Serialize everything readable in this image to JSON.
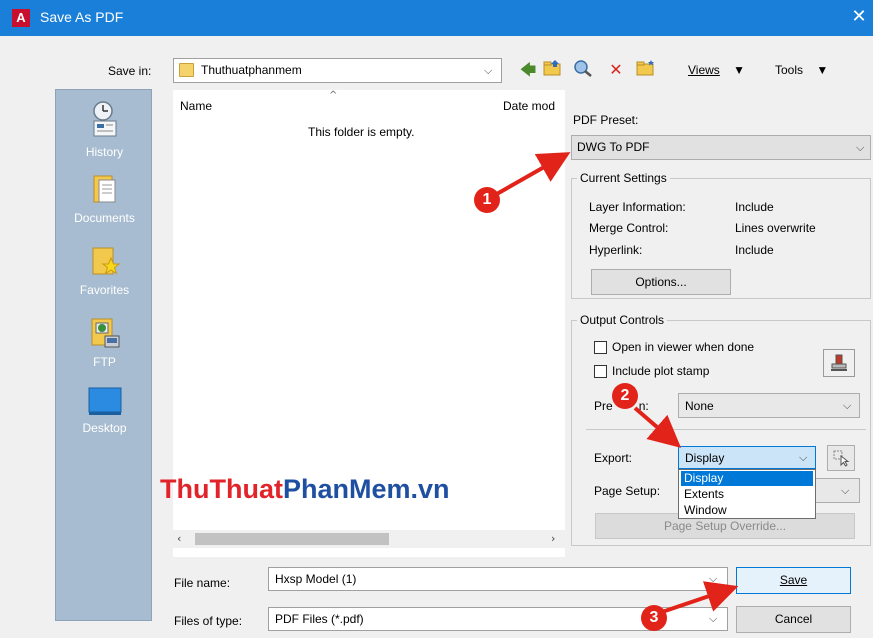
{
  "window": {
    "title": "Save As PDF",
    "close_glyph": "✕"
  },
  "savein": {
    "label": "Save in:",
    "value": "Thuthuatphanmem"
  },
  "toolbar": {
    "views": "Views",
    "tools": "Tools"
  },
  "places": [
    {
      "label": "History",
      "icon": "history-icon"
    },
    {
      "label": "Documents",
      "icon": "documents-icon"
    },
    {
      "label": "Favorites",
      "icon": "favorites-icon"
    },
    {
      "label": "FTP",
      "icon": "ftp-icon"
    },
    {
      "label": "Desktop",
      "icon": "desktop-icon"
    }
  ],
  "filelist": {
    "col_name": "Name",
    "col_date": "Date mod",
    "empty_message": "This folder is empty."
  },
  "watermark": {
    "part1": "ThuThuat",
    "part2": "PhanMem",
    "part3": ".vn"
  },
  "preset": {
    "label": "PDF Preset:",
    "value": "DWG To PDF"
  },
  "current_settings": {
    "title": "Current Settings",
    "rows": [
      {
        "key": "Layer Information:",
        "value": "Include"
      },
      {
        "key": "Merge Control:",
        "value": "Lines overwrite"
      },
      {
        "key": "Hyperlink:",
        "value": "Include"
      }
    ],
    "options_button": "Options..."
  },
  "output_controls": {
    "title": "Output Controls",
    "open_viewer": "Open in viewer when done",
    "include_stamp": "Include plot stamp",
    "precision_label": "Pre",
    "precision_label_tail": "n:",
    "precision_value": "None",
    "export_label": "Export:",
    "export_value": "Display",
    "export_options": [
      "Display",
      "Extents",
      "Window"
    ],
    "page_setup_label": "Page Setup:",
    "page_setup_override": "Page Setup Override..."
  },
  "filename": {
    "label": "File name:",
    "value": "Hxsp Model (1)"
  },
  "filetype": {
    "label": "Files of type:",
    "value": "PDF Files (*.pdf)"
  },
  "buttons": {
    "save": "Save",
    "cancel": "Cancel"
  },
  "badges": [
    "1",
    "2",
    "3"
  ],
  "colors": {
    "titlebar": "#1a7fd8",
    "badge": "#e2231a",
    "watermark_red": "#e0242a",
    "watermark_blue": "#1e4fa1",
    "selection": "#0078d7"
  }
}
